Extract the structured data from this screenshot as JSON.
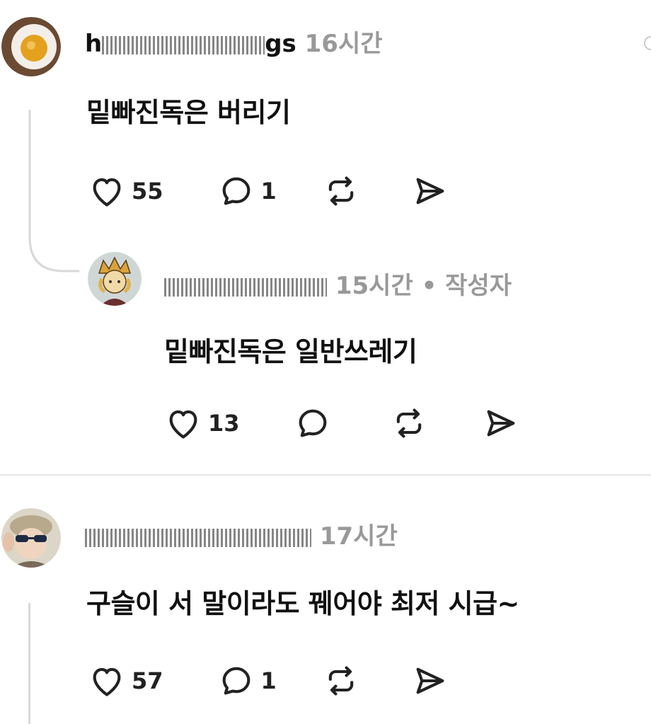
{
  "colors": {
    "text": "#111111",
    "muted": "#999999",
    "divider": "#e6e6e6",
    "icon": "#222222"
  },
  "comments": [
    {
      "username_visible_start": "h",
      "username_visible_end": "gs",
      "time": "16시간",
      "author_tag": "",
      "text": "밑빠진독은 버리기",
      "likes": "55",
      "replies": "1",
      "avatar": "tea-cup-avatar"
    },
    {
      "username_visible_start": "",
      "username_visible_end": "",
      "time": "15시간",
      "author_tag": "• 작성자",
      "text": "밑빠진독은 일반쓰레기",
      "likes": "13",
      "replies": "",
      "avatar": "cartoon-avatar"
    },
    {
      "username_visible_start": "",
      "username_visible_end": "",
      "time": "17시간",
      "author_tag": "",
      "text": "구슬이 서 말이라도 꿰어야 최저 시급~",
      "likes": "57",
      "replies": "1",
      "avatar": "sunglasses-avatar"
    }
  ],
  "icons": [
    "heart-icon",
    "comment-icon",
    "repost-icon",
    "share-icon",
    "more-icon"
  ]
}
